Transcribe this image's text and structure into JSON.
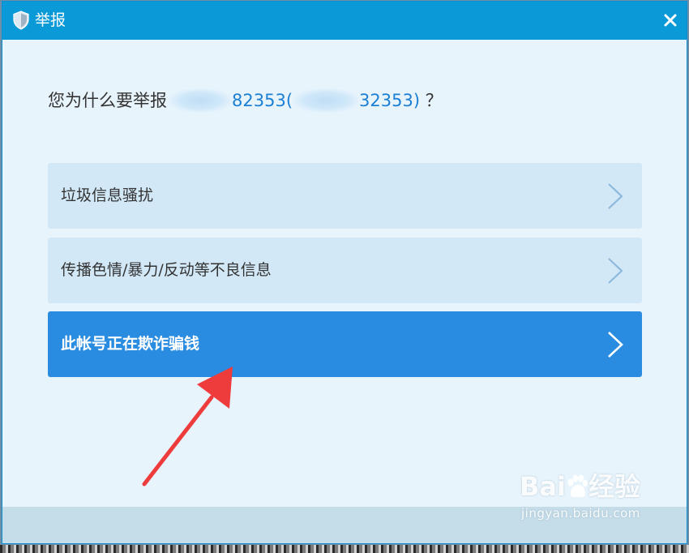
{
  "dialog": {
    "title": "举报",
    "question_prefix": "您为什么要举报",
    "account_name_visible": "82353",
    "account_id_open": "(",
    "account_id_visible": "32353)",
    "question_suffix": " ？"
  },
  "options": [
    {
      "label": "垃圾信息骚扰",
      "selected": false
    },
    {
      "label": "传播色情/暴力/反动等不良信息",
      "selected": false
    },
    {
      "label": "此帐号正在欺诈骗钱",
      "selected": true
    }
  ],
  "watermark": {
    "brand_left": "Bai",
    "brand_right": "经验",
    "url": "jingyan.baidu.com"
  },
  "colors": {
    "titlebar": "#0b9ad8",
    "dialog_bg": "#e8f4fc",
    "option_bg": "#d2e8f7",
    "option_selected_bg": "#2a8ce0",
    "link": "#1b7fd4",
    "annotation_arrow": "#ee3b3b"
  },
  "icons": {
    "title": "shield-icon",
    "close": "close-icon",
    "option": "chevron-right-icon",
    "annotation": "red-arrow-annotation"
  }
}
